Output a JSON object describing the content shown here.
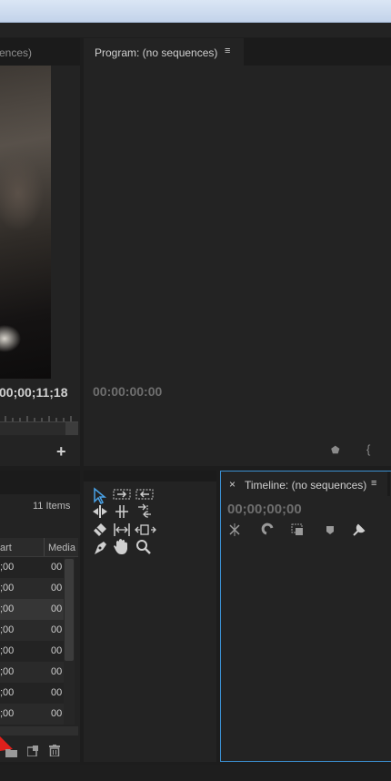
{
  "source_panel": {
    "tab_label": "ences)",
    "timecode": "00;00;11;18",
    "add_button": "+"
  },
  "program_panel": {
    "tab_label": "Program: (no sequences)",
    "menu_icon": "≡",
    "timecode": "00:00:00:00",
    "marker_icon": "⬟",
    "in_icon": "{"
  },
  "project_panel": {
    "item_count": "11 Items",
    "columns": [
      "art",
      "Media"
    ],
    "rows": [
      {
        "start": ";00",
        "media": "00"
      },
      {
        "start": ";00",
        "media": "00"
      },
      {
        "start": ";00",
        "media": "00"
      },
      {
        "start": ";00",
        "media": "00"
      },
      {
        "start": ";00",
        "media": "00"
      },
      {
        "start": ";00",
        "media": "00"
      },
      {
        "start": ";00",
        "media": "00"
      },
      {
        "start": ";00",
        "media": "00"
      }
    ]
  },
  "tools": [
    "selection-tool",
    "track-select-forward-tool",
    "track-select-backward-tool",
    "ripple-edit-tool",
    "rolling-edit-tool",
    "rate-stretch-tool",
    "razor-tool",
    "slip-tool",
    "slide-tool",
    "pen-tool",
    "hand-tool",
    "zoom-tool"
  ],
  "timeline_panel": {
    "close_icon": "×",
    "tab_label": "Timeline: (no sequences)",
    "menu_icon": "≡",
    "timecode": "00;00;00;00"
  },
  "colors": {
    "accent": "#4aa3e8",
    "panel_bg": "#232323",
    "arrow": "#e0201c"
  }
}
